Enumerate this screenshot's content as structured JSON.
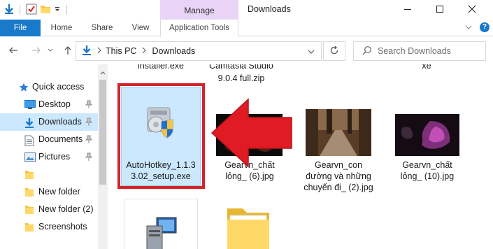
{
  "titlebar": {
    "contextual_tab_group": "Manage",
    "window_title": "Downloads"
  },
  "ribbon": {
    "tabs": [
      "File",
      "Home",
      "Share",
      "View",
      "Application Tools"
    ]
  },
  "address": {
    "crumbs": [
      "This PC",
      "Downloads"
    ],
    "search_placeholder": "Search Downloads"
  },
  "nav": {
    "quick_access": "Quick access",
    "items": [
      "Desktop",
      "Downloads",
      "Documents",
      "Pictures",
      "",
      "New folder",
      "New folder (2)",
      "Screenshots"
    ]
  },
  "files": {
    "partial_top": [
      "installer.exe",
      "Camtasia Studio",
      "9.0.4 full.zip",
      "xe"
    ],
    "row1": [
      {
        "name_line1": "AutoHotkey_1.1.3",
        "name_line2": "3.02_setup.exe"
      },
      {
        "name_line1": "Gearvn_chất",
        "name_line2": "lỏng_ (6).jpg"
      },
      {
        "name_line1": "Gearvn_con",
        "name_line2": "đường và những",
        "name_line3": "chuyến đi_ (2).jpg"
      },
      {
        "name_line1": "Gearvn_chất",
        "name_line2": "lỏng_ (10).jpg"
      }
    ]
  },
  "colors": {
    "accent": "#1979ca",
    "selection": "#cce8ff",
    "contextual": "#e9d4f5",
    "annotation_red": "#d62128"
  }
}
